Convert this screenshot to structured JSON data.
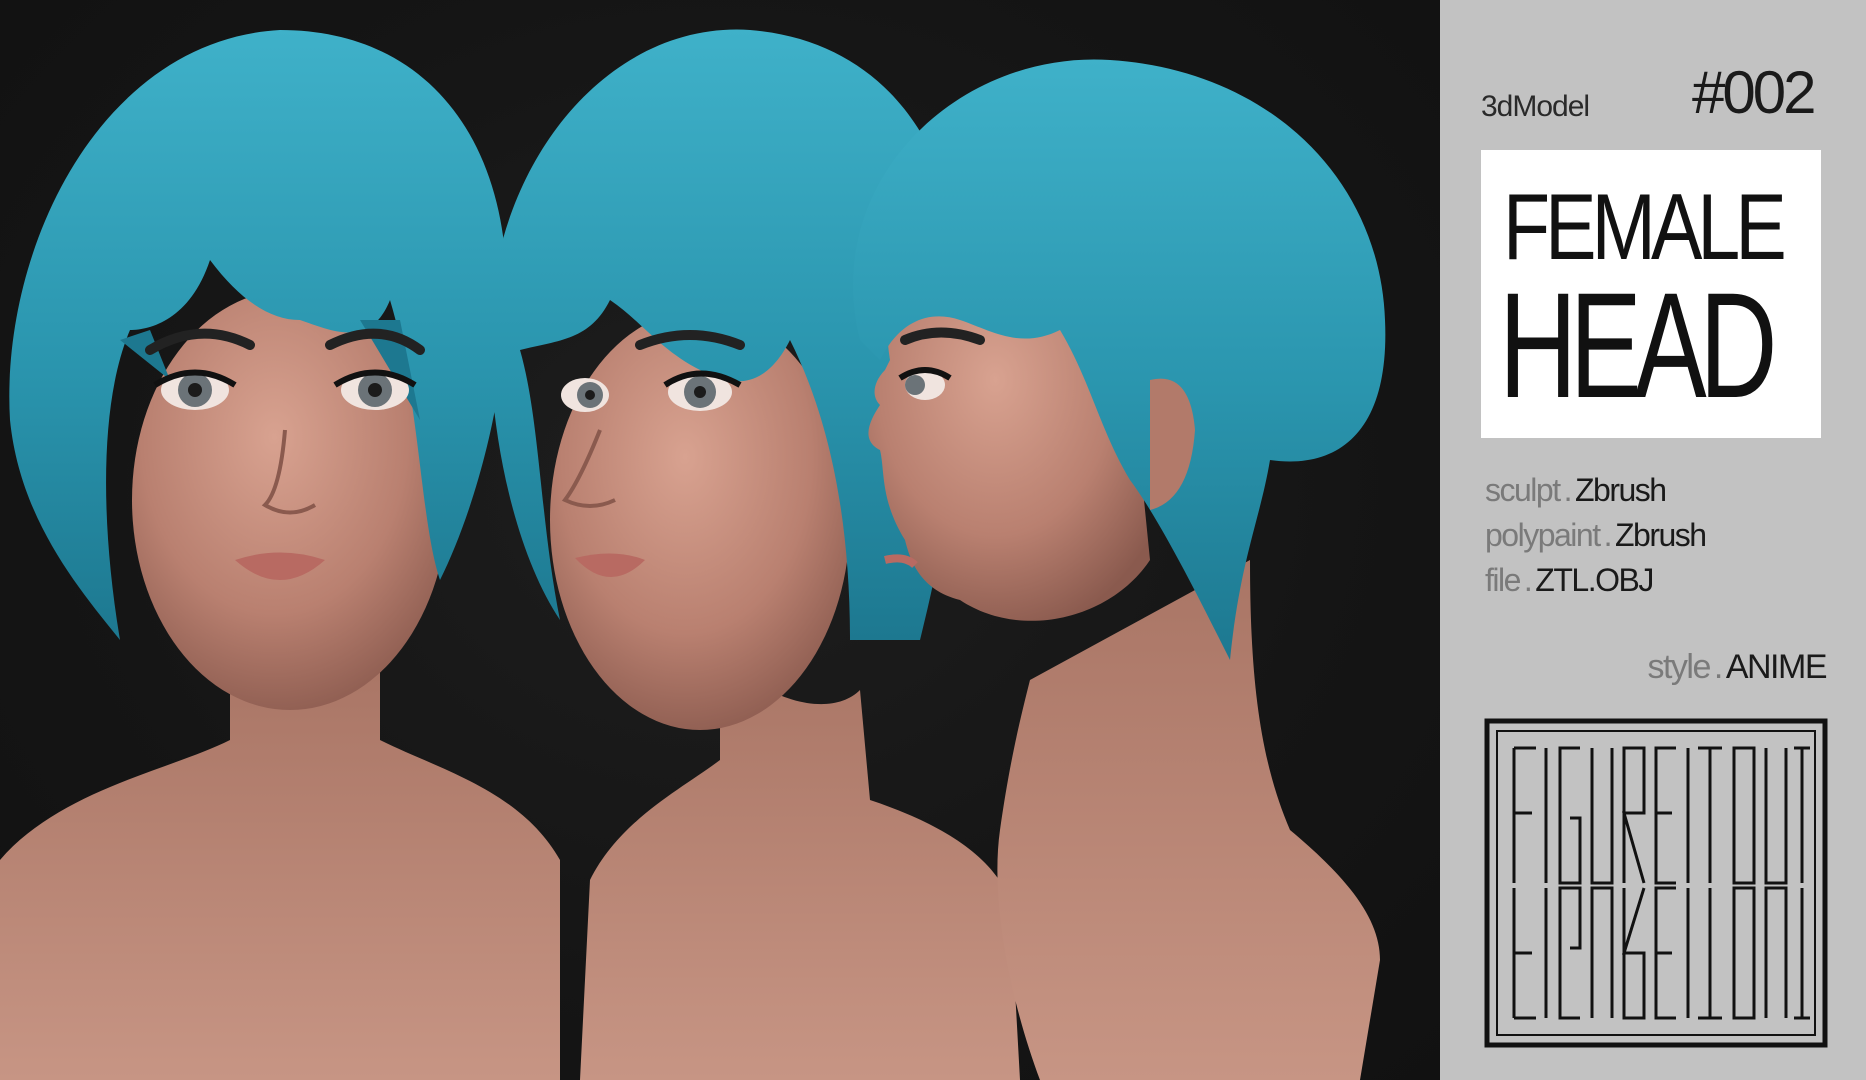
{
  "panel": {
    "label": "3dModel",
    "number": "#002",
    "title_line1": "FEMALE",
    "title_line2": "HEAD",
    "specs": [
      {
        "key": "sculpt",
        "value": "Zbrush"
      },
      {
        "key": "polypaint",
        "value": "Zbrush"
      },
      {
        "key": "file",
        "value": "ZTL.OBJ"
      }
    ],
    "style": {
      "key": "style",
      "value": "ANIME"
    },
    "logo_text": "FIGURE IT OUT"
  },
  "colors": {
    "hair": "#2a98b2",
    "skin": "#c08876",
    "background": "#141414",
    "panel": "#c2c2c2"
  }
}
